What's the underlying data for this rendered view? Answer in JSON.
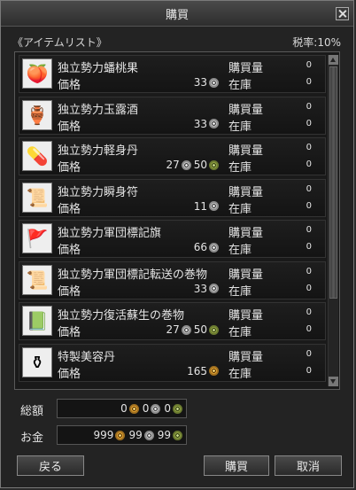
{
  "window": {
    "title": "購買"
  },
  "header": {
    "list_label": "《アイテムリスト》",
    "tax_label": "税率:10%"
  },
  "labels": {
    "price": "価格",
    "qty": "購買量",
    "stock": "在庫"
  },
  "items": [
    {
      "name": "独立勢力蟠桃果",
      "icon": "peach-icon",
      "glyph": "🍑",
      "prices": [
        {
          "value": "33",
          "coin": "silver"
        }
      ],
      "qty": "0",
      "stock": "0"
    },
    {
      "name": "独立勢力玉露酒",
      "icon": "wine-jug-icon",
      "glyph": "🏺",
      "prices": [
        {
          "value": "33",
          "coin": "silver"
        }
      ],
      "qty": "0",
      "stock": "0"
    },
    {
      "name": "独立勢力軽身丹",
      "icon": "pill-icon",
      "glyph": "💊",
      "prices": [
        {
          "value": "27",
          "coin": "silver"
        },
        {
          "value": "50",
          "coin": "green"
        }
      ],
      "qty": "0",
      "stock": "0"
    },
    {
      "name": "独立勢力瞬身符",
      "icon": "talisman-icon",
      "glyph": "📜",
      "prices": [
        {
          "value": "11",
          "coin": "silver"
        }
      ],
      "qty": "0",
      "stock": "0"
    },
    {
      "name": "独立勢力軍団標記旗",
      "icon": "flag-icon",
      "glyph": "🚩",
      "prices": [
        {
          "value": "66",
          "coin": "silver"
        }
      ],
      "qty": "0",
      "stock": "0"
    },
    {
      "name": "独立勢力軍団標記転送の巻物",
      "icon": "scroll-icon",
      "glyph": "📜",
      "prices": [
        {
          "value": "33",
          "coin": "silver"
        }
      ],
      "qty": "0",
      "stock": "0"
    },
    {
      "name": "独立勢力復活蘇生の巻物",
      "icon": "revival-scroll-icon",
      "glyph": "📗",
      "prices": [
        {
          "value": "27",
          "coin": "silver"
        },
        {
          "value": "50",
          "coin": "green"
        }
      ],
      "qty": "0",
      "stock": "0"
    },
    {
      "name": "特製美容丹",
      "icon": "beauty-vase-icon",
      "glyph": "⚱",
      "prices": [
        {
          "value": "165",
          "coin": "gold"
        }
      ],
      "qty": "0",
      "stock": "0"
    }
  ],
  "totals": {
    "total_label": "総額",
    "total": [
      {
        "value": "0",
        "coin": "gold"
      },
      {
        "value": "0",
        "coin": "silver"
      },
      {
        "value": "0",
        "coin": "green"
      }
    ],
    "money_label": "お金",
    "money": [
      {
        "value": "999",
        "coin": "gold"
      },
      {
        "value": "99",
        "coin": "silver"
      },
      {
        "value": "99",
        "coin": "green"
      }
    ]
  },
  "buttons": {
    "back": "戻る",
    "buy": "購買",
    "cancel": "取消"
  }
}
